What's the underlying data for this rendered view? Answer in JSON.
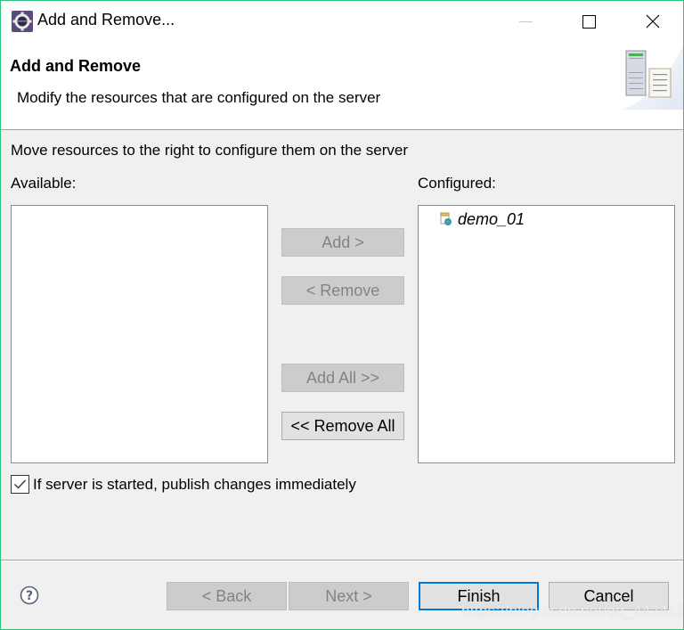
{
  "window": {
    "title": "Add and Remove...",
    "app_icon": "eclipse-gear-icon",
    "controls": {
      "minimize": "minimize-icon",
      "maximize": "maximize-icon",
      "close": "close-icon",
      "close_glyph": "✕"
    }
  },
  "banner": {
    "title": "Add and Remove",
    "description": "Modify the resources that are configured on the server",
    "art_icon": "server-wizard-banner-icon"
  },
  "body": {
    "instruction": "Move resources to the right to configure them on the server",
    "available": {
      "label": "Available:",
      "items": []
    },
    "configured": {
      "label": "Configured:",
      "items": [
        {
          "name": "demo_01",
          "icon": "web-project-icon"
        }
      ]
    },
    "buttons": {
      "add": {
        "label": "Add >",
        "enabled": false
      },
      "remove": {
        "label": "< Remove",
        "enabled": false
      },
      "add_all": {
        "label": "Add All >>",
        "enabled": false
      },
      "remove_all": {
        "label": "<< Remove All",
        "enabled": true
      }
    },
    "publish_checkbox": {
      "label": "If server is started, publish changes immediately",
      "checked": true
    }
  },
  "footer": {
    "help_icon": "help-icon",
    "help_glyph": "?",
    "back": {
      "label": "< Back",
      "enabled": false
    },
    "next": {
      "label": "Next >",
      "enabled": false
    },
    "finish": {
      "label": "Finish",
      "enabled": true,
      "default": true
    },
    "cancel": {
      "label": "Cancel",
      "enabled": true
    }
  },
  "watermark": "https://blog.csdn.net/qq_44241551",
  "colors": {
    "window_border": "#2ec27e",
    "default_button_border": "#0078d7",
    "dialog_background": "#f0f0f0",
    "disabled_button": "#cccccc"
  }
}
